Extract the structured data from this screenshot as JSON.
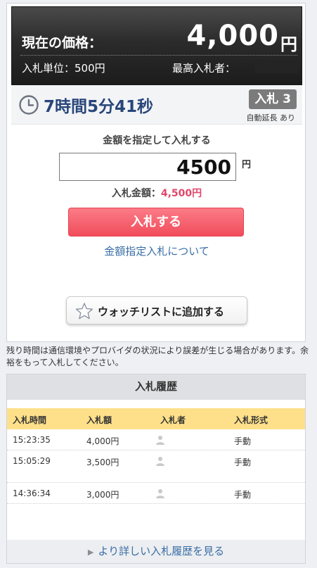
{
  "price": {
    "label": "現在の価格：",
    "value": "4,000",
    "unit": "円",
    "bid_unit": "入札単位：500円",
    "top_bidder_label": "最高入札者："
  },
  "time": {
    "remaining": "7時間5分41秒",
    "bid_count": "入札 3",
    "auto_extend": "自動延長 あり"
  },
  "bid_form": {
    "instruction": "金額を指定して入札する",
    "input_value": "4500",
    "input_unit": "円",
    "amount_label": "入札金額：",
    "amount_value": "4,500円",
    "submit_label": "入札する",
    "help_link": "金額指定入札について"
  },
  "watchlist": {
    "label": "ウォッチリストに追加する"
  },
  "note": "残り時間は通信環境やプロバイダの状況により誤差が生じる場合があります。余裕をもって入札してください。",
  "history": {
    "title": "入札履歴",
    "columns": [
      "入札時間",
      "入札額",
      "入札者",
      "入札形式"
    ],
    "rows": [
      {
        "time": "15:23:35",
        "amount": "4,000円",
        "type": "手動"
      },
      {
        "time": "15:05:29",
        "amount": "3,500円",
        "type": "手動"
      },
      {
        "time": "14:36:34",
        "amount": "3,000円",
        "type": "手動"
      }
    ],
    "more_link": "より詳しい入札履歴を見る"
  },
  "icons": {
    "clock": "clock-icon",
    "star": "star-icon",
    "person": "person-icon",
    "arrow": "chevron-right-icon"
  },
  "colors": {
    "accent_red": "#f14c5b",
    "amount_pink": "#e2476a",
    "link_blue": "#3a6ea5",
    "time_navy": "#28467a",
    "history_header": "#ffe08a"
  }
}
